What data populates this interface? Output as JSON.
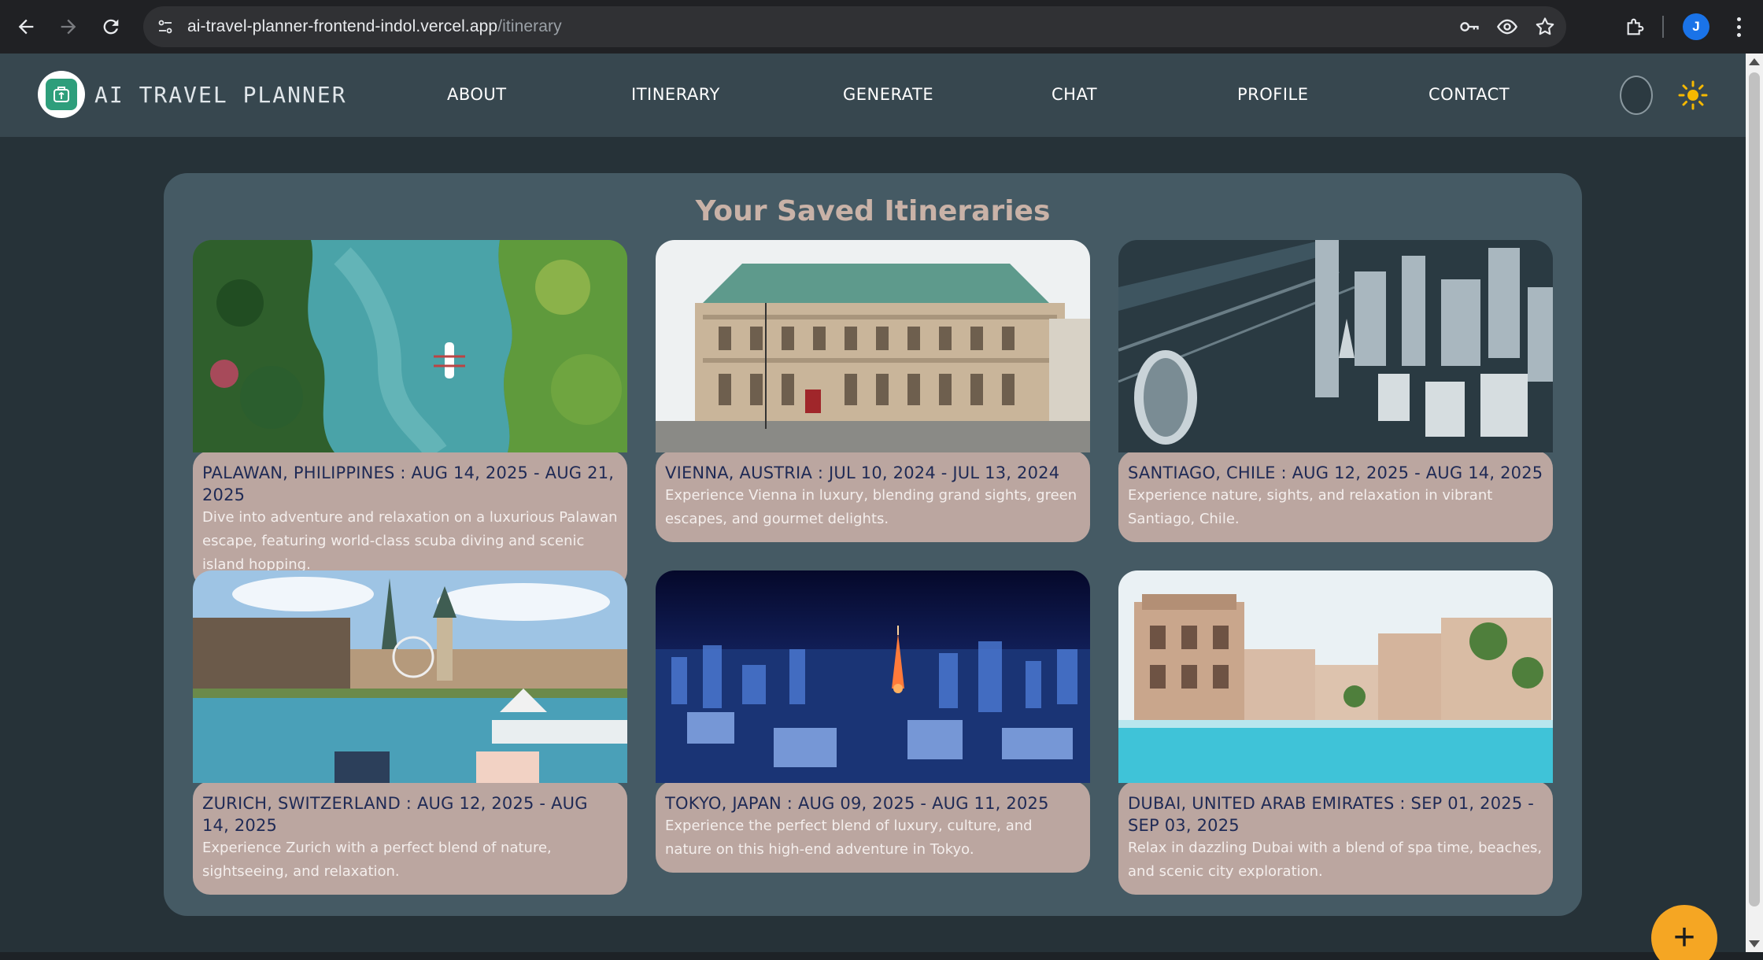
{
  "browser": {
    "url_host": "ai-travel-planner-frontend-indol.vercel.app",
    "url_path": "/itinerary",
    "profile_initial": "J"
  },
  "header": {
    "brand": "AI TRAVEL PLANNER",
    "nav": [
      {
        "label": "ABOUT"
      },
      {
        "label": "ITINERARY"
      },
      {
        "label": "GENERATE"
      },
      {
        "label": "CHAT"
      },
      {
        "label": "PROFILE"
      },
      {
        "label": "CONTACT"
      }
    ]
  },
  "main": {
    "title": "Your Saved Itineraries",
    "cards": [
      {
        "title": "PALAWAN, PHILIPPINES : AUG 14, 2025 - AUG 21, 2025",
        "description": "Dive into adventure and relaxation on a luxurious Palawan escape, featuring world-class scuba diving and scenic island hopping.",
        "image": "palawan-aerial-photo"
      },
      {
        "title": "VIENNA, AUSTRIA : JUL 10, 2024 - JUL 13, 2024",
        "description": "Experience Vienna in luxury, blending grand sights, green escapes, and gourmet delights.",
        "image": "vienna-opera-photo"
      },
      {
        "title": "SANTIAGO, CHILE : AUG 12, 2025 - AUG 14, 2025",
        "description": "Experience nature, sights, and relaxation in vibrant Santiago, Chile.",
        "image": "santiago-city-photo"
      },
      {
        "title": "ZURICH, SWITZERLAND : AUG 12, 2025 - AUG 14, 2025",
        "description": "Experience Zurich with a perfect blend of nature, sightseeing, and relaxation.",
        "image": "zurich-harbor-photo"
      },
      {
        "title": "TOKYO, JAPAN : AUG 09, 2025 - AUG 11, 2025",
        "description": "Experience the perfect blend of luxury, culture, and nature on this high-end adventure in Tokyo.",
        "image": "tokyo-night-photo"
      },
      {
        "title": "DUBAI, UNITED ARAB EMIRATES : SEP 01, 2025 - SEP 03, 2025",
        "description": "Relax in dazzling Dubai with a blend of spa time, beaches, and scenic city exploration.",
        "image": "dubai-resort-photo"
      }
    ]
  },
  "fab": {
    "label": "+"
  },
  "colors": {
    "page_bg": "#263238",
    "header_bg": "#37474f",
    "panel_bg": "#455a64",
    "card_body": "#bba6a0",
    "card_title": "#1f2a55",
    "accent": "#f5a623"
  }
}
